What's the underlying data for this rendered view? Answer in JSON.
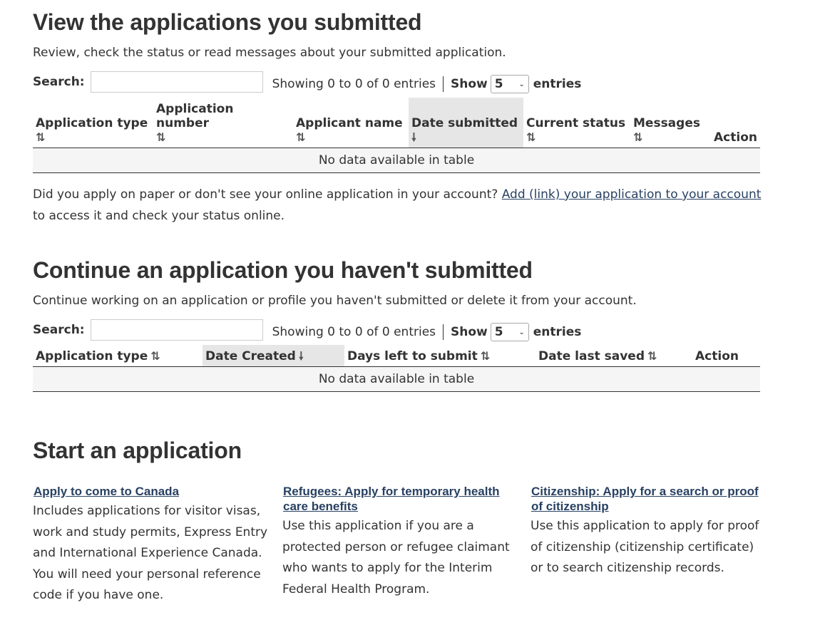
{
  "submitted": {
    "title": "View the applications you submitted",
    "lead": "Review, check the status or read messages about your submitted application.",
    "search_label": "Search:",
    "info": "Showing 0 to 0 of 0 entries",
    "show_label": "Show",
    "show_value": "5",
    "entries_label": "entries",
    "columns": [
      {
        "label": "Application type",
        "sort": "⇅"
      },
      {
        "label": "Application number",
        "sort": "⇅"
      },
      {
        "label": "Applicant name",
        "sort": "⇅"
      },
      {
        "label": "Date submitted",
        "sort": "🠗"
      },
      {
        "label": "Current status",
        "sort": "⇅"
      },
      {
        "label": "Messages",
        "sort": "⇅"
      },
      {
        "label": "Action"
      }
    ],
    "empty": "No data available in table"
  },
  "paper_note": {
    "before": "Did you apply on paper or don't see your online application in your account?",
    "link": "Add (link) your application to your account",
    "after": "to access it and check your status online."
  },
  "continue": {
    "title": "Continue an application you haven't submitted",
    "lead": "Continue working on an application or profile you haven't submitted or delete it from your account.",
    "search_label": "Search:",
    "info": "Showing 0 to 0 of 0 entries",
    "show_label": "Show",
    "show_value": "5",
    "entries_label": "entries",
    "columns": [
      {
        "label": "Application type",
        "sort": "⇅"
      },
      {
        "label": "Date Created",
        "sort": "🠗"
      },
      {
        "label": "Days left to submit",
        "sort": "⇅"
      },
      {
        "label": "Date last saved",
        "sort": "⇅"
      },
      {
        "label": "Action"
      }
    ],
    "empty": "No data available in table"
  },
  "start": {
    "title": "Start an application",
    "cards": [
      {
        "link": "Apply to come to Canada",
        "desc": "Includes applications for visitor visas, work and study permits, Express Entry and International Experience Canada. You will need your personal reference code if you have one."
      },
      {
        "link": "Refugees: Apply for temporary health care benefits",
        "desc": "Use this application if you are a protected person or refugee claimant who wants to apply for the Interim Federal Health Program."
      },
      {
        "link": "Citizenship: Apply for a search or proof of citizenship",
        "desc": "Use this application to apply for proof of citizenship (citizenship certificate) or to search citizenship records."
      }
    ]
  },
  "colors": {
    "text": "#333333",
    "link": "#284162",
    "sorted_header_bg": "#e6e6e6",
    "empty_row_bg": "#f5f5f5"
  },
  "icons": {
    "sortable": "sort-both-icon",
    "sorted_desc": "sort-down-icon",
    "select_caret": "chevron-down-icon"
  }
}
